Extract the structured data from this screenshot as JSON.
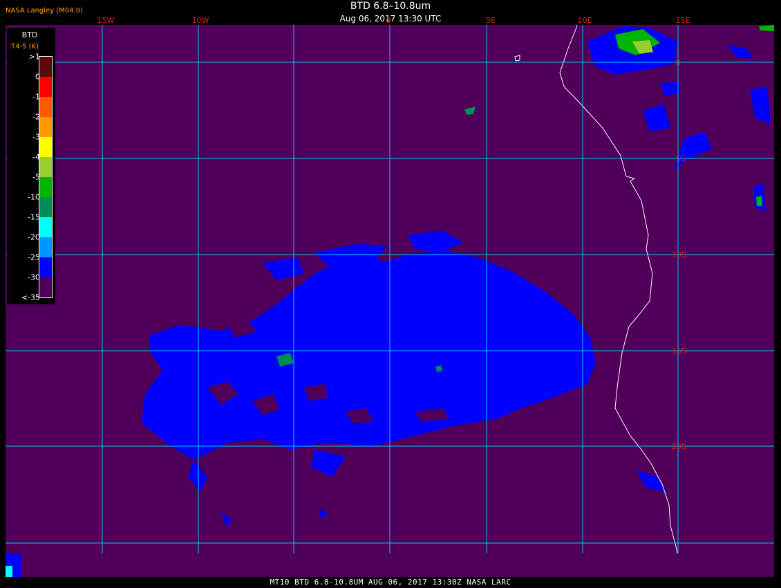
{
  "header": {
    "credit": "NASA Langley (M04.0)",
    "title": "BTD 6.8–10.8um",
    "subtitle": "Aug 06, 2017 13:30 UTC"
  },
  "footer": {
    "text": "MT10  BTD 6.8-10.8UM   AUG 06, 2017 13:30Z   NASA LARC"
  },
  "legend": {
    "title": "BTD",
    "units": "T4-5 (K)",
    "labels": [
      ">1",
      "0",
      "-1",
      "-2",
      "-3",
      "-4",
      "-5",
      "-10",
      "-15",
      "-20",
      "-25",
      "-30",
      "<-35"
    ],
    "colors": [
      "#5a0a0a",
      "#ff0000",
      "#ff5a00",
      "#ff9a00",
      "#ffff00",
      "#9acd32",
      "#00b400",
      "#008c5a",
      "#00ffff",
      "#0096ff",
      "#0000ff",
      "#50005a"
    ]
  },
  "map": {
    "background_color": "#50005a",
    "grid_color": "#00c8ff",
    "coast_color": "#ffffff",
    "cloud_color": "#0000ff",
    "lon_labels": [
      "15W",
      "10W",
      "0",
      "5E",
      "10E",
      "15E"
    ],
    "lat_labels": [
      "0",
      "5S",
      "10S",
      "15S",
      "20S"
    ]
  }
}
